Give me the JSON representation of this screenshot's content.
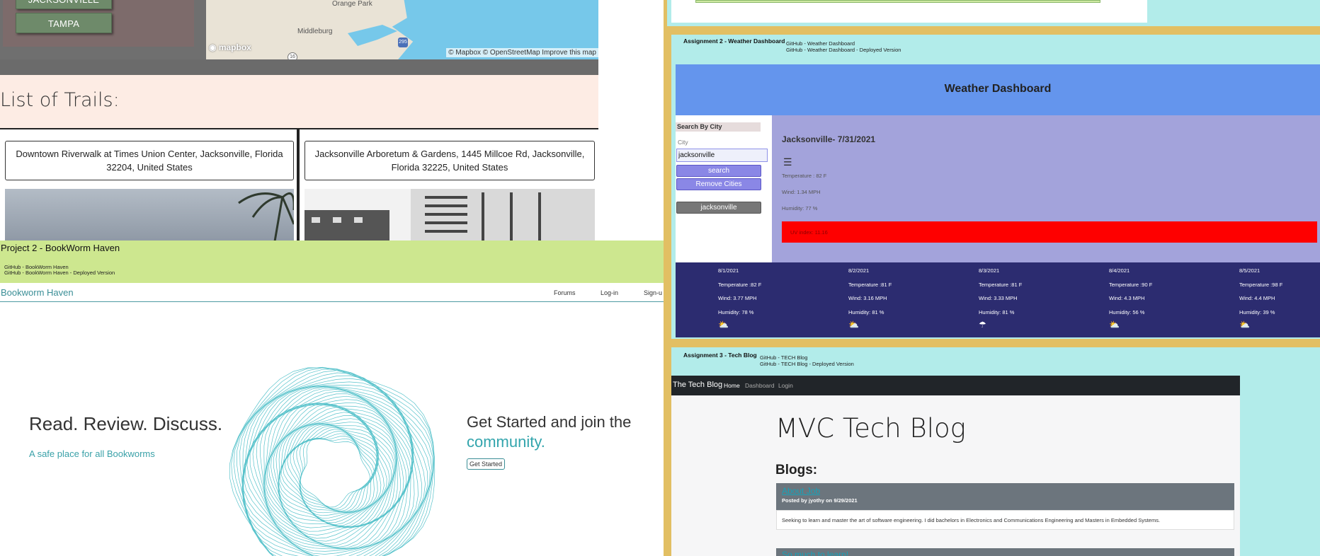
{
  "trail_project": {
    "cities": [
      "JACKSONVILLE",
      "TAMPA"
    ],
    "map": {
      "places": [
        "Orange Park",
        "Middleburg"
      ],
      "highway": "295",
      "route": "16",
      "logo": "mapbox",
      "credit": "© Mapbox © OpenStreetMap Improve this map"
    },
    "heading": "List of Trails:",
    "trails": [
      "Downtown Riverwalk at Times Union Center, Jacksonville, Florida 32204, United States",
      "Jacksonville Arboretum & Gardens, 1445 Millcoe Rd, Jacksonville, Florida 32225, United States"
    ]
  },
  "project2": {
    "title": "Project 2 - BookWorm Haven",
    "repo_link": "GitHub - BookWorm Haven",
    "deployed_link": "GitHub - BookWorm Haven - Deployed Version",
    "site": {
      "logo": "Bookworm Haven",
      "nav": [
        "Forums",
        "Log-in",
        "Sign-u"
      ],
      "hero_title": "Read. Review. Discuss.",
      "hero_sub": "A safe place for all Bookworms",
      "cta_title": "Get Started and join the",
      "cta_accent": "community.",
      "cta_button": "Get Started"
    }
  },
  "assignment2": {
    "title": "Assignment 2 - Weather Dashboard",
    "repo_link": "GitHub - Weather Dashboard",
    "deployed_link": "GitHub - Weather Dashboard - Deployed Version",
    "header": "Weather Dashboard",
    "search_heading": "Search By City",
    "city_label": "City",
    "city_value": "jacksonville",
    "search_button": "search",
    "remove_button": "Remove Cities",
    "history": [
      "jacksonville"
    ],
    "current": {
      "city_date": "Jacksonville- 7/31/2021",
      "icon": "fog-icon",
      "temperature": "Temperature : 82 F",
      "wind": "Wind: 1.34 MPH",
      "humidity": "Humidity: 77 %",
      "uv": "UV index: 11.16"
    },
    "forecast": [
      {
        "date": "8/1/2021",
        "temp": "Temperature :82 F",
        "wind": "Wind: 3.77 MPH",
        "humidity": "Humidity: 78 %",
        "icon": "partly-cloudy-icon"
      },
      {
        "date": "8/2/2021",
        "temp": "Temperature :81 F",
        "wind": "Wind: 3.16 MPH",
        "humidity": "Humidity: 81 %",
        "icon": "partly-cloudy-icon"
      },
      {
        "date": "8/3/2021",
        "temp": "Temperature :81 F",
        "wind": "Wind: 3.33 MPH",
        "humidity": "Humidity: 81 %",
        "icon": "rain-icon"
      },
      {
        "date": "8/4/2021",
        "temp": "Temperature :90 F",
        "wind": "Wind: 4.3 MPH",
        "humidity": "Humidity: 56 %",
        "icon": "partly-cloudy-icon"
      },
      {
        "date": "8/5/2021",
        "temp": "Temperature :98 F",
        "wind": "Wind: 4.4 MPH",
        "humidity": "Humidity: 39 %",
        "icon": "partly-cloudy-icon"
      }
    ]
  },
  "assignment3": {
    "title": "Assignment 3 - Tech Blog",
    "repo_link": "GitHub - TECH Blog",
    "deployed_link": "GitHub - TECH Blog - Deployed Version",
    "site": {
      "brand": "The Tech Blog",
      "nav": [
        "Home",
        "Dashboard",
        "Login"
      ],
      "heading": "MVC Tech Blog",
      "blogs_heading": "Blogs:",
      "posts": [
        {
          "title": "About Job",
          "meta": "Posted by jyothy on 9/29/2021",
          "body": "Seeking to learn and master the art of software engineering. I did bachelors in Electronics and Communications Engineering and Masters in Embedded Systems."
        },
        {
          "title": "So much to learn!"
        }
      ]
    }
  }
}
